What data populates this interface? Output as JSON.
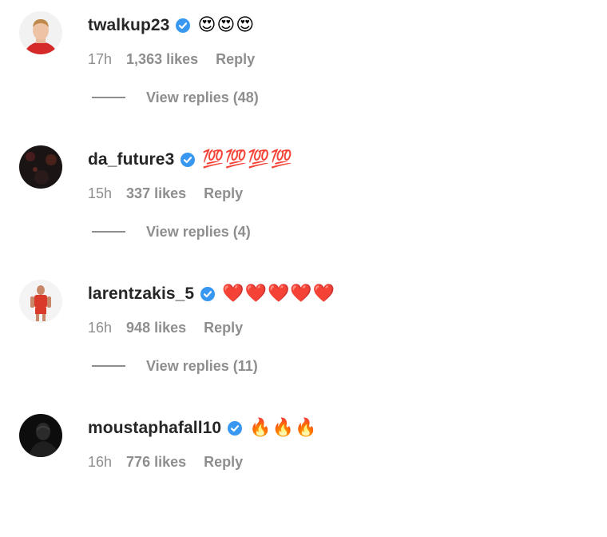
{
  "colors": {
    "verified_badge": "#3897f0",
    "username_text": "#262626",
    "meta_text": "#8e8e8e"
  },
  "comments": [
    {
      "username": "twalkup23",
      "verified": true,
      "text": "😍😍😍",
      "time": "17h",
      "likes": "1,363 likes",
      "reply_label": "Reply",
      "view_replies": "View replies (48)"
    },
    {
      "username": "da_future3",
      "verified": true,
      "text": "💯💯💯💯",
      "time": "15h",
      "likes": "337 likes",
      "reply_label": "Reply",
      "view_replies": "View replies (4)"
    },
    {
      "username": "larentzakis_5",
      "verified": true,
      "text": "❤️❤️❤️❤️❤️",
      "time": "16h",
      "likes": "948 likes",
      "reply_label": "Reply",
      "view_replies": "View replies (11)"
    },
    {
      "username": "moustaphafall10",
      "verified": true,
      "text": "🔥🔥🔥",
      "time": "16h",
      "likes": "776 likes",
      "reply_label": "Reply"
    }
  ]
}
